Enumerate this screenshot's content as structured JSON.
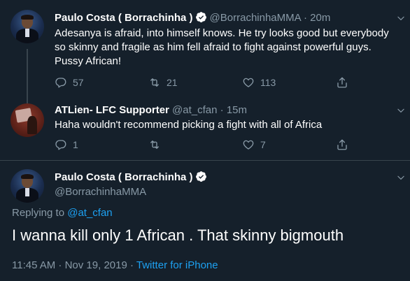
{
  "tweets": [
    {
      "name": "Paulo Costa ( Borrachinha )",
      "handle": "@BorrachinhaMMA",
      "time": "20m",
      "text": "Adesanya is afraid, into himself knows. He try looks good but everybody so skinny and fragile as him fell afraid to fight against powerful guys. Pussy African!",
      "replies": "57",
      "retweets": "21",
      "likes": "113"
    },
    {
      "name": "ATLien- LFC Supporter",
      "handle": "@at_cfan",
      "time": "15m",
      "text": "Haha wouldn't recommend picking a fight with all of Africa",
      "replies": "1",
      "retweets": "",
      "likes": "7"
    }
  ],
  "main_tweet": {
    "name": "Paulo Costa ( Borrachinha )",
    "handle": "@BorrachinhaMMA",
    "replying_prefix": "Replying to ",
    "replying_to": "@at_cfan",
    "text": "I wanna kill only 1 African . That skinny bigmouth",
    "timestamp": "11:45 AM · Nov 19, 2019 · ",
    "source": "Twitter for iPhone"
  },
  "separator": "·",
  "colors": {
    "background": "#15202b",
    "text": "#ffffff",
    "secondary": "#8899a6",
    "accent": "#1da1f2",
    "divider": "#38444d"
  },
  "icons": [
    "verified-badge-icon",
    "chevron-down-icon",
    "reply-icon",
    "retweet-icon",
    "like-icon",
    "share-icon"
  ]
}
